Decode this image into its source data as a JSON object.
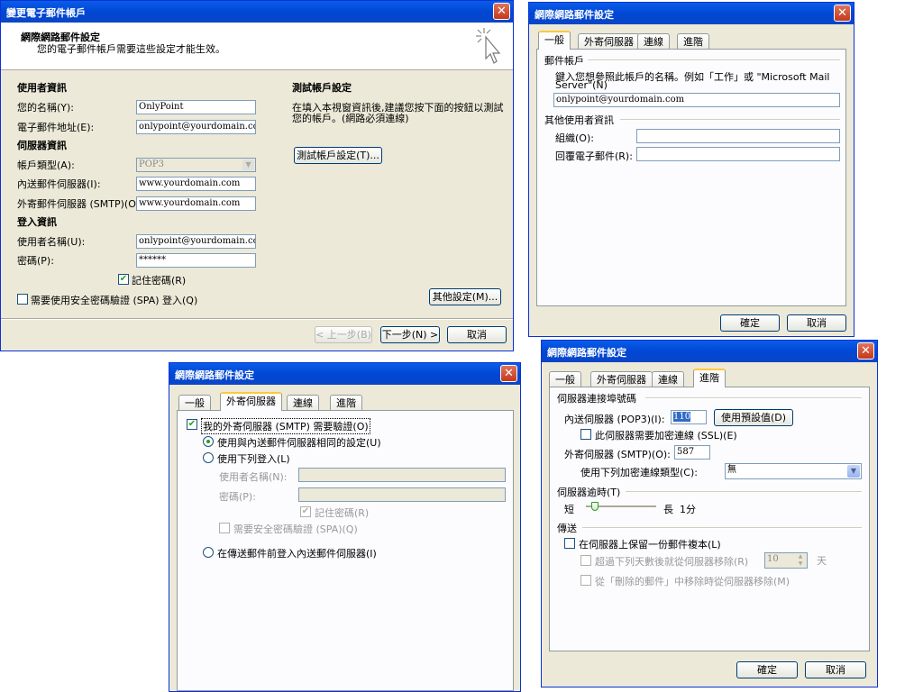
{
  "d1": {
    "title": "變更電子郵件帳戶",
    "close": "✕",
    "header_title": "網際網路郵件設定",
    "header_sub": "您的電子郵件帳戶需要這些設定才能生效。",
    "user_info": "使用者資訊",
    "name_label": "您的名稱(Y):",
    "name_value": "OnlyPoint",
    "email_label": "電子郵件地址(E):",
    "email_value": "onlypoint@yourdomain.com",
    "server_info": "伺服器資訊",
    "acct_type_label": "帳戶類型(A):",
    "acct_type_value": "POP3",
    "incoming_label": "內送郵件伺服器(I):",
    "incoming_value": "www.yourdomain.com",
    "outgoing_label": "外寄郵件伺服器 (SMTP)(O):",
    "outgoing_value": "www.yourdomain.com",
    "logon_info": "登入資訊",
    "username_label": "使用者名稱(U):",
    "username_value": "onlypoint@yourdomain.com",
    "password_label": "密碼(P):",
    "password_value": "******",
    "remember_label": "記住密碼(R)",
    "spa_label": "需要使用安全密碼驗證 (SPA) 登入(Q)",
    "test_title": "測試帳戶設定",
    "test_desc1": "在填入本視窗資訊後,建議您按下面的按鈕以測試",
    "test_desc2": "您的帳戶。(網路必須連線)",
    "test_button": "測試帳戶設定(T)...",
    "more_button": "其他設定(M)...",
    "back_button": "< 上一步(B)",
    "next_button": "下一步(N) >",
    "cancel_button": "取消"
  },
  "d2": {
    "title": "網際網路郵件設定",
    "close": "✕",
    "tabs": [
      "一般",
      "外寄伺服器",
      "連線",
      "進階"
    ],
    "mail_account": "郵件帳戶",
    "desc1": "鍵入您想參照此帳戶的名稱。例如「工作」或 \"Microsoft Mail",
    "desc2": "Server\"(N)",
    "account_value": "onlypoint@yourdomain.com",
    "other_user_info": "其他使用者資訊",
    "org_label": "組織(O):",
    "reply_label": "回覆電子郵件(R):",
    "ok": "確定",
    "cancel": "取消"
  },
  "d3": {
    "title": "網際網路郵件設定",
    "close": "✕",
    "tabs": [
      "一般",
      "外寄伺服器",
      "連線",
      "進階"
    ],
    "smtp_auth": "我的外寄伺服器 (SMTP) 需要驗證(O)",
    "same_settings": "使用與內送郵件伺服器相同的設定(U)",
    "logon_using": "使用下列登入(L)",
    "username_label": "使用者名稱(N):",
    "password_label": "密碼(P):",
    "remember": "記住密碼(R)",
    "spa": "需要安全密碼驗證 (SPA)(Q)",
    "logon_incoming": "在傳送郵件前登入內送郵件伺服器(I)"
  },
  "d4": {
    "title": "網際網路郵件設定",
    "close": "✕",
    "tabs": [
      "一般",
      "外寄伺服器",
      "連線",
      "進階"
    ],
    "port_numbers": "伺服器連接埠號碼",
    "incoming_label": "內送伺服器 (POP3)(I):",
    "incoming_value": "110",
    "defaults_button": "使用預設值(D)",
    "ssl_label": "此伺服器需要加密連線 (SSL)(E)",
    "outgoing_label": "外寄伺服器 (SMTP)(O):",
    "outgoing_value": "587",
    "encrypt_label": "使用下列加密連線類型(C):",
    "encrypt_value": "無",
    "timeout_title": "伺服器逾時(T)",
    "short": "短",
    "long": "長",
    "timeout_value": "1分",
    "timeout_level": 0.08,
    "delivery": "傳送",
    "leave_copy": "在伺服器上保留一份郵件複本(L)",
    "remove_after": "超過下列天數後就從伺服器移除(R)",
    "days_value": "10",
    "days_unit": "天",
    "remove_deleted": "從「刪除的郵件」中移除時從伺服器移除(M)",
    "ok": "確定",
    "cancel": "取消"
  }
}
